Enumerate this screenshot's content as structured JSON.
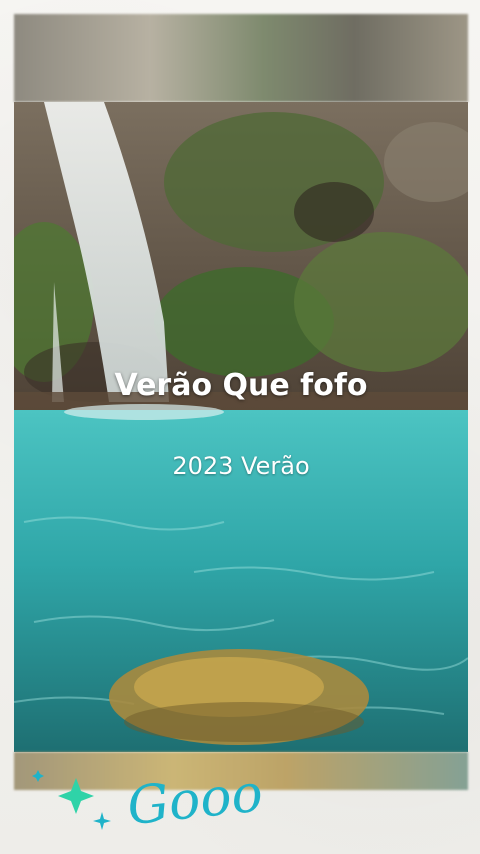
{
  "story": {
    "title": "Verão Que fofo",
    "subtitle": "2023 Verão",
    "sticker_text": "Gooo"
  },
  "colors": {
    "water": "#36b3b2",
    "text": "#ffffff",
    "sticker": "#1fb3c9"
  },
  "icons": {
    "sparkle": "sparkle-icon"
  }
}
